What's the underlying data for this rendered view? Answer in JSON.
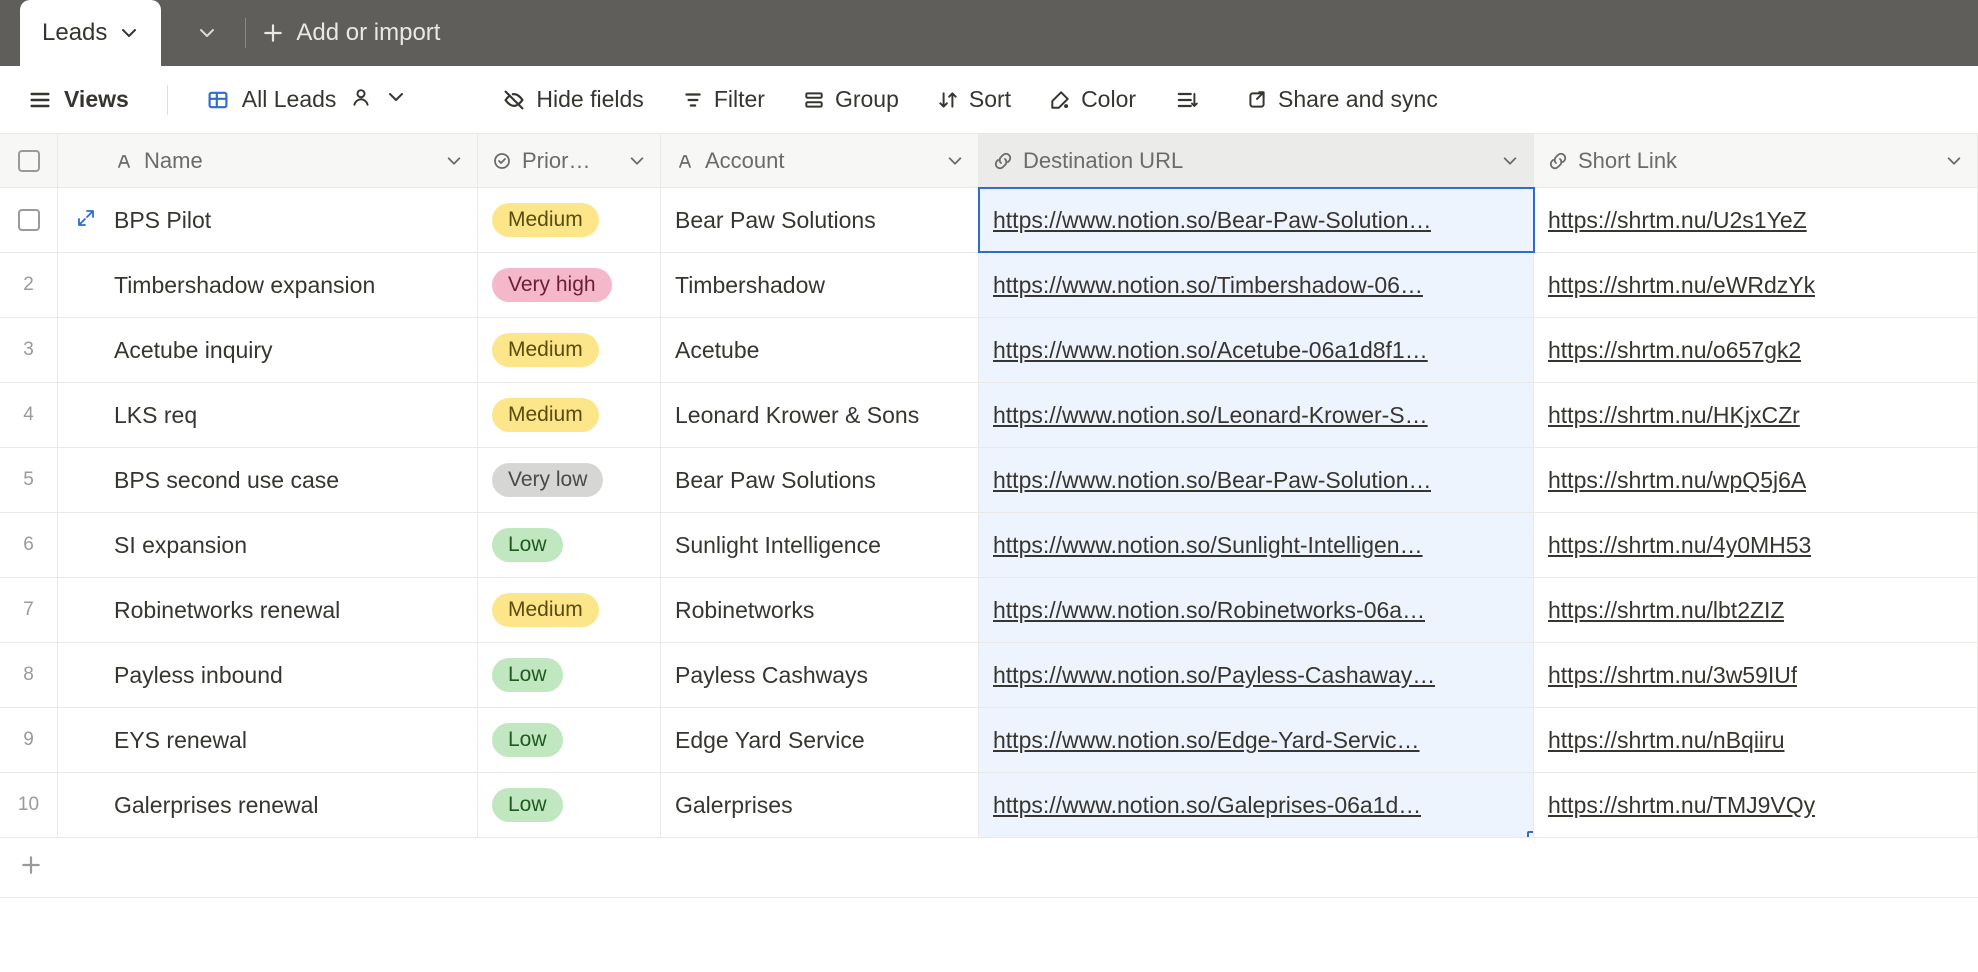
{
  "tabbar": {
    "active_tab": "Leads",
    "add_import": "Add or import"
  },
  "toolbar": {
    "views": "Views",
    "all_leads": "All Leads",
    "hide_fields": "Hide fields",
    "filter": "Filter",
    "group": "Group",
    "sort": "Sort",
    "color": "Color",
    "share": "Share and sync"
  },
  "columns": {
    "name": "Name",
    "priority": "Prior…",
    "account": "Account",
    "url": "Destination URL",
    "short": "Short Link"
  },
  "priority_styles": {
    "Medium": "medium",
    "Very high": "veryhigh",
    "Very low": "verylow",
    "Low": "low"
  },
  "rows": [
    {
      "num": "",
      "name": "BPS Pilot",
      "priority": "Medium",
      "account": "Bear Paw Solutions",
      "url": "https://www.notion.so/Bear-Paw-Solution…",
      "short": "https://shrtm.nu/U2s1YeZ",
      "selected": true,
      "checkbox": true
    },
    {
      "num": "2",
      "name": "Timbershadow expansion",
      "priority": "Very high",
      "account": "Timbershadow",
      "url": "https://www.notion.so/Timbershadow-06…",
      "short": "https://shrtm.nu/eWRdzYk"
    },
    {
      "num": "3",
      "name": "Acetube inquiry",
      "priority": "Medium",
      "account": "Acetube",
      "url": "https://www.notion.so/Acetube-06a1d8f1…",
      "short": "https://shrtm.nu/o657gk2"
    },
    {
      "num": "4",
      "name": "LKS req",
      "priority": "Medium",
      "account": "Leonard Krower & Sons",
      "url": "https://www.notion.so/Leonard-Krower-S…",
      "short": "https://shrtm.nu/HKjxCZr"
    },
    {
      "num": "5",
      "name": "BPS second use case",
      "priority": "Very low",
      "account": "Bear Paw Solutions",
      "url": "https://www.notion.so/Bear-Paw-Solution…",
      "short": "https://shrtm.nu/wpQ5j6A"
    },
    {
      "num": "6",
      "name": "SI expansion",
      "priority": "Low",
      "account": "Sunlight Intelligence",
      "url": "https://www.notion.so/Sunlight-Intelligen…",
      "short": "https://shrtm.nu/4y0MH53"
    },
    {
      "num": "7",
      "name": "Robinetworks renewal",
      "priority": "Medium",
      "account": "Robinetworks",
      "url": "https://www.notion.so/Robinetworks-06a…",
      "short": "https://shrtm.nu/lbt2ZIZ"
    },
    {
      "num": "8",
      "name": "Payless inbound",
      "priority": "Low",
      "account": "Payless Cashways",
      "url": "https://www.notion.so/Payless-Cashaway…",
      "short": "https://shrtm.nu/3w59IUf"
    },
    {
      "num": "9",
      "name": "EYS renewal",
      "priority": "Low",
      "account": "Edge Yard Service",
      "url": "https://www.notion.so/Edge-Yard-Servic…",
      "short": "https://shrtm.nu/nBqiiru"
    },
    {
      "num": "10",
      "name": "Galerprises renewal",
      "priority": "Low",
      "account": "Galerprises",
      "url": "https://www.notion.so/Galeprises-06a1d…",
      "short": "https://shrtm.nu/TMJ9VQy",
      "last_in_selection_col": true
    }
  ]
}
